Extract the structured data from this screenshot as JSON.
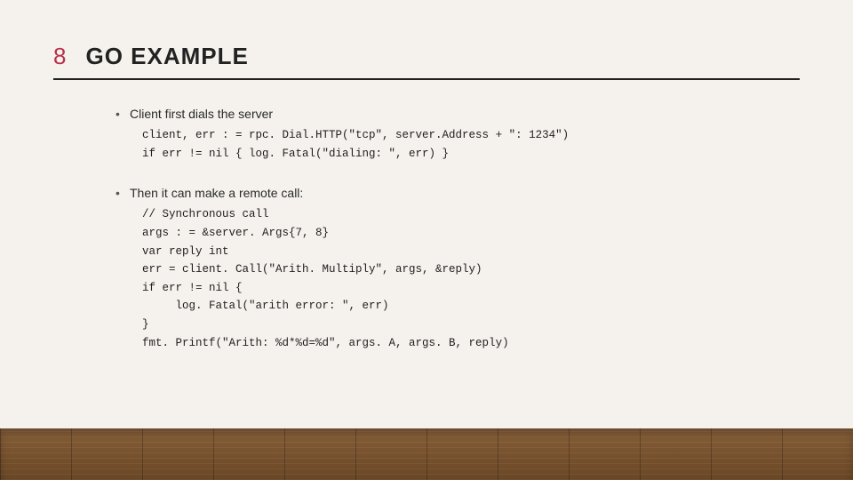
{
  "page_number": "8",
  "title": "GO EXAMPLE",
  "bullets": [
    {
      "lead": "Client first dials the server",
      "code": [
        "client, err : = rpc. Dial.HTTP(\"tcp\", server.Address + \": 1234\")",
        "if err != nil { log. Fatal(\"dialing: \", err) }"
      ]
    },
    {
      "lead": "Then it can make a remote call:",
      "code": [
        "// Synchronous call",
        "args : = &server. Args{7, 8}",
        "var reply int",
        "err = client. Call(\"Arith. Multiply\", args, &reply)",
        "if err != nil {",
        "     log. Fatal(\"arith error: \", err)",
        "}",
        "fmt. Printf(\"Arith: %d*%d=%d\", args. A, args. B, reply)"
      ]
    }
  ],
  "colors": {
    "accent": "#b93049",
    "background": "#f5f2ed"
  }
}
